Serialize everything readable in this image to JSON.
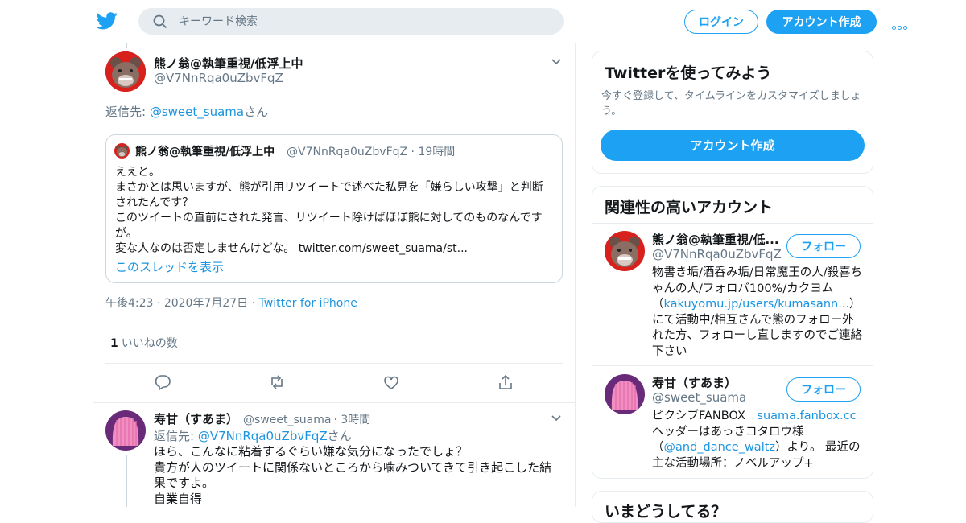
{
  "nav": {
    "search_placeholder": "キーワード検索",
    "login_label": "ログイン",
    "signup_label": "アカウント作成",
    "icons": [
      "twitter-bird-icon",
      "search-icon",
      "more-icon"
    ]
  },
  "tweet": {
    "author_name": "熊ノ翁@執筆重視/低浮上中",
    "author_handle": "@V7NnRqa0uZbvFqZ",
    "reply_prefix": "返信先: ",
    "reply_target": "@sweet_suama",
    "reply_suffix": "さん",
    "quoted": {
      "author_name": "熊ノ翁@執筆重視/低浮上中",
      "author_handle": "@V7NnRqa0uZbvFqZ",
      "time": "19時間",
      "text": "ええと。\nまさかとは思いますが、熊が引用リツイートで述べた私見を「嫌らしい攻撃」と判断されたんです？\nこのツイートの直前にされた発言、リツイート除けばほぼ熊に対してのものなんですが。\n変な人なのは否定しませんけどな。 twitter.com/sweet_suama/st...",
      "show_thread": "このスレッドを表示"
    },
    "time": "午後4:23",
    "date": "2020年7月27日",
    "source": "Twitter for iPhone",
    "like_count": "1",
    "like_label": "いいねの数",
    "actions": [
      "reply-icon",
      "retweet-icon",
      "like-icon",
      "share-icon"
    ]
  },
  "reply": {
    "author_name": "寿甘（すあま）",
    "author_handle": "@sweet_suama",
    "time": "3時間",
    "reply_prefix": "返信先: ",
    "reply_target": "@V7NnRqa0uZbvFqZ",
    "reply_suffix": "さん",
    "text": "ほら、こんなに粘着するぐらい嫌な気分になったでしょ？\n貴方が人のツイートに関係ないところから噛みついてきて引き起こした結果ですよ。\n自業自得"
  },
  "sidebar": {
    "signup_card": {
      "title": "Twitterを使ってみよう",
      "desc": "今すぐ登録して、タイムラインをカスタマイズしましょう。",
      "button": "アカウント作成"
    },
    "related": {
      "title": "関連性の高いアカウント",
      "follow_label": "フォロー",
      "accounts": [
        {
          "name": "熊ノ翁@執筆重視/低...",
          "handle": "@V7NnRqa0uZbvFqZ",
          "bio_1": "物書き垢/酒呑み垢/日常魔王の人/殺喜ちゃんの人/フォロバ100%/カクヨム（",
          "bio_link": "kakuyomu.jp/users/kumasann...",
          "bio_2": "）にて活動中/相互さんで熊のフォロー外れた方、フォローし直しますのでご連絡下さい"
        },
        {
          "name": "寿甘（すあま）",
          "handle": "@sweet_suama",
          "bio_1": "ピクシブFANBOX　",
          "bio_link": "suama.fanbox.cc",
          "bio_2": "\nヘッダーはあっきコタロウ様（",
          "bio_link2": "@and_dance_waltz",
          "bio_3": "）より。 最近の主な活動場所：ノベルアップ+"
        }
      ]
    },
    "trending_title": "いまどうしてる？"
  }
}
